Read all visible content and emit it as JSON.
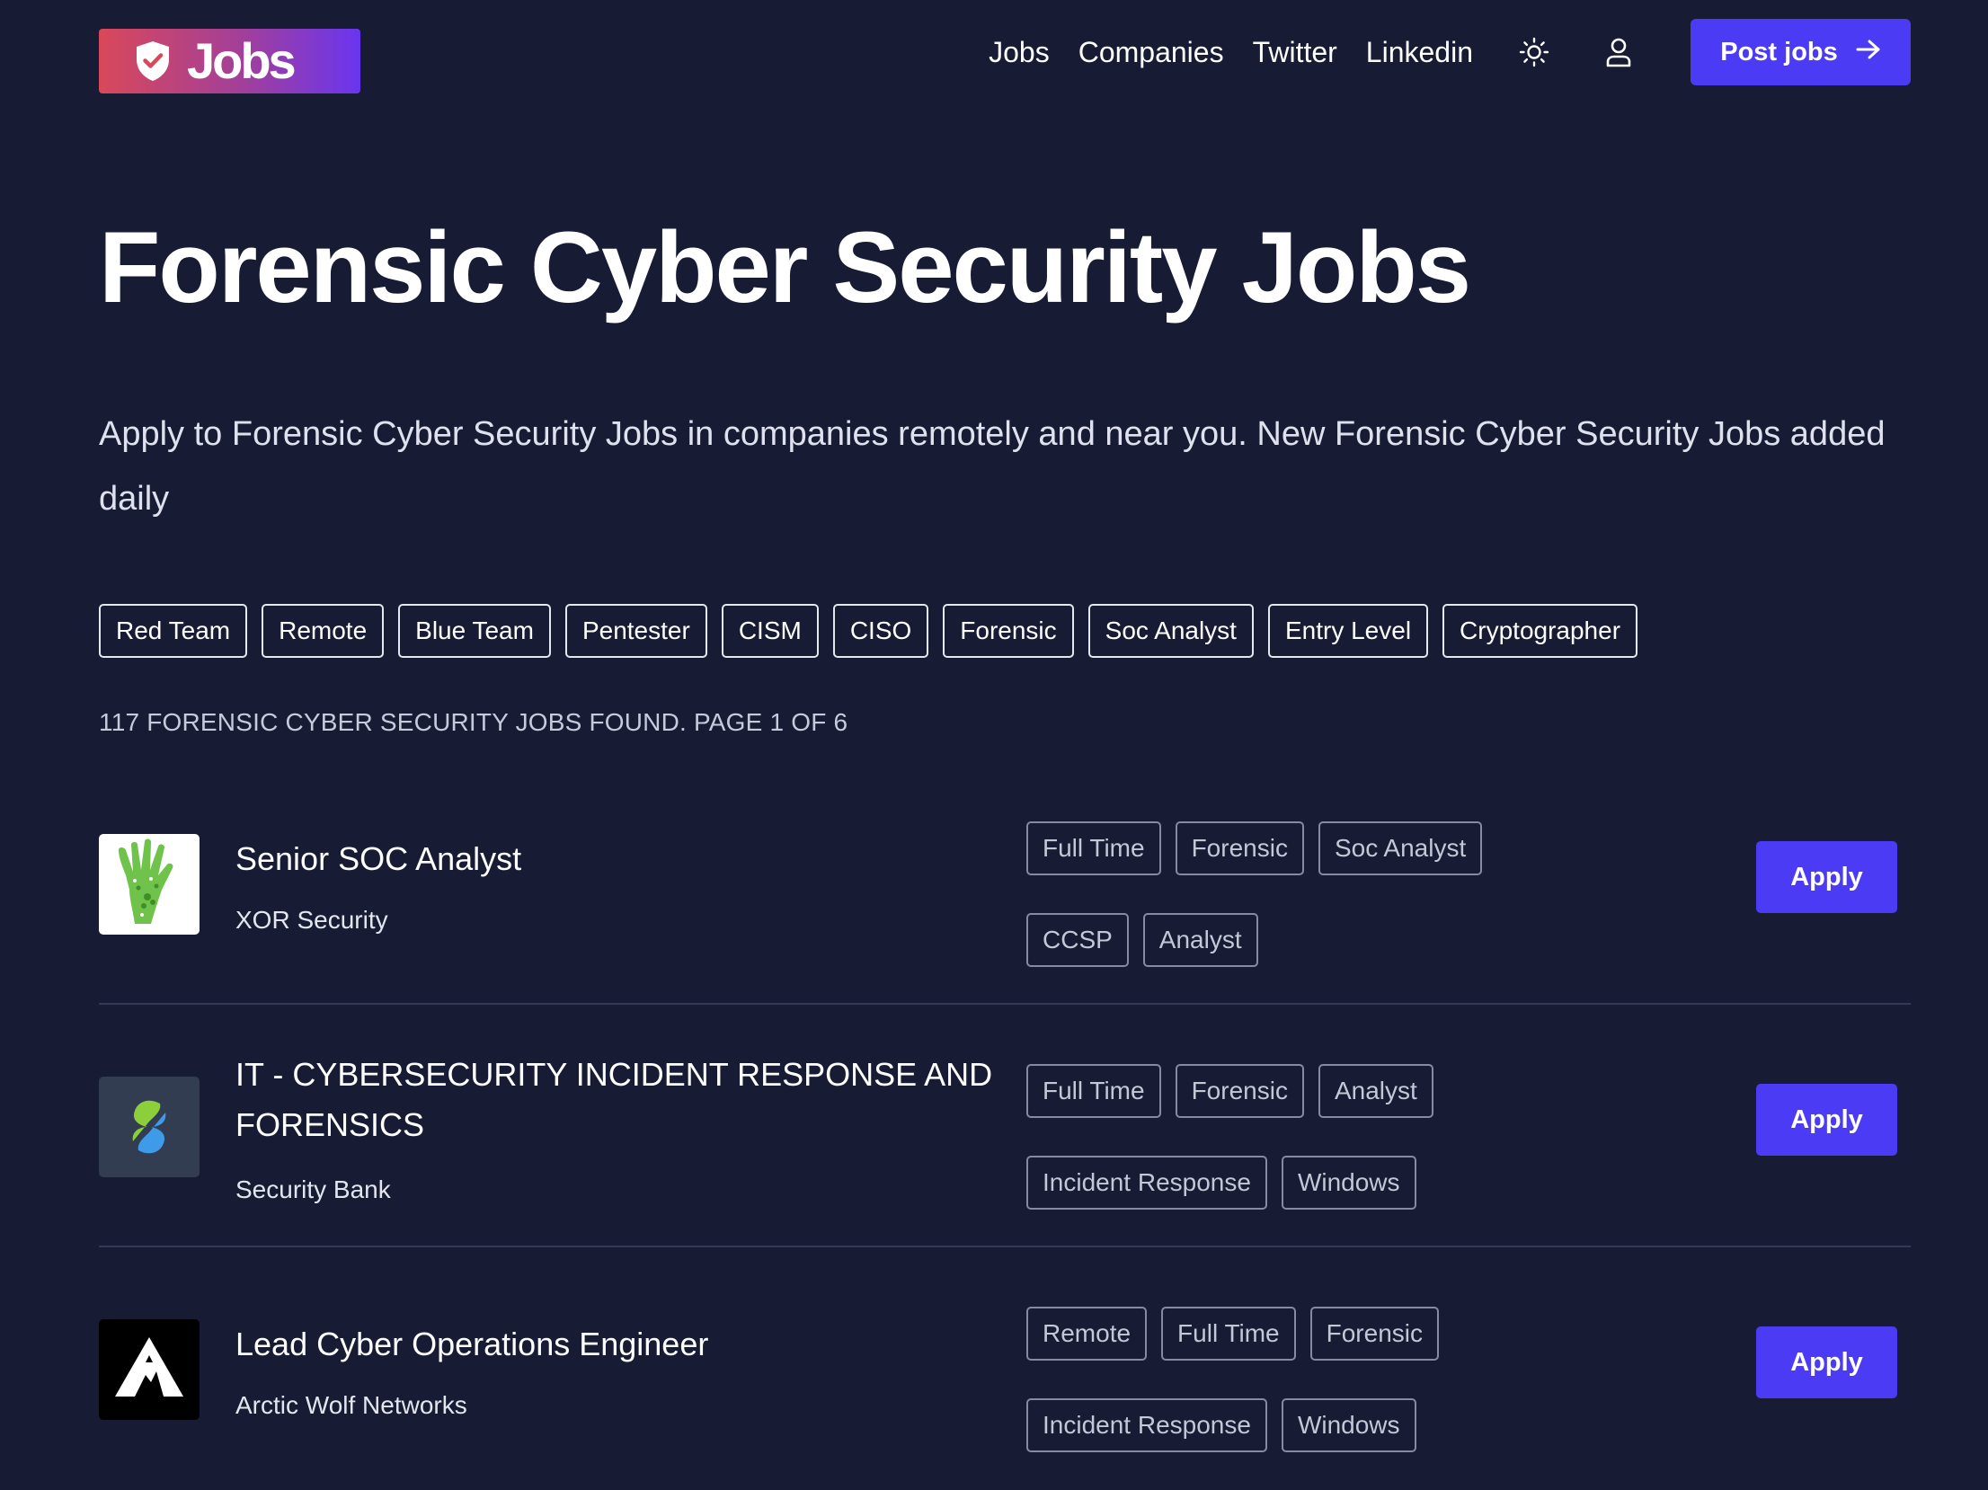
{
  "header": {
    "logo_text": "Jobs",
    "nav_links": [
      "Jobs",
      "Companies",
      "Twitter",
      "Linkedin"
    ],
    "theme_toggle_icon": "sun-icon",
    "account_icon": "user-icon",
    "post_jobs_label": "Post jobs",
    "post_jobs_icon": "arrow-right-icon"
  },
  "hero": {
    "title": "Forensic Cyber Security Jobs",
    "subtitle": "Apply to Forensic Cyber Security Jobs in companies remotely and near you. New Forensic Cyber Security Jobs added daily"
  },
  "filters": [
    "Red Team",
    "Remote",
    "Blue Team",
    "Pentester",
    "CISM",
    "CISO",
    "Forensic",
    "Soc Analyst",
    "Entry Level",
    "Cryptographer"
  ],
  "results": {
    "summary": "117 Forensic Cyber Security Jobs found. Page 1 of 6"
  },
  "jobs": [
    {
      "title": "Senior SOC Analyst",
      "company": "XOR Security",
      "tags": [
        "Full Time",
        "Forensic",
        "Soc Analyst",
        "CCSP",
        "Analyst"
      ],
      "apply_label": "Apply"
    },
    {
      "title": "IT - CYBERSECURITY INCIDENT RESPONSE AND FORENSICS",
      "company": "Security Bank",
      "tags": [
        "Full Time",
        "Forensic",
        "Analyst",
        "Incident Response",
        "Windows"
      ],
      "apply_label": "Apply"
    },
    {
      "title": "Lead Cyber Operations Engineer",
      "company": "Arctic Wolf Networks",
      "tags": [
        "Remote",
        "Full Time",
        "Forensic",
        "Incident Response",
        "Windows"
      ],
      "apply_label": "Apply"
    }
  ],
  "colors": {
    "background": "#171b34",
    "accent": "#4b3bf5",
    "logo_gradient_start": "#d9485a",
    "logo_gradient_end": "#6a35f0"
  }
}
